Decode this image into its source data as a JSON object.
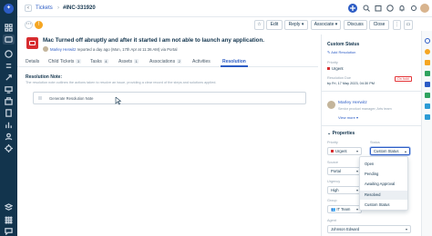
{
  "breadcrumb": {
    "parent": "Tickets",
    "current": "#INC-331920"
  },
  "toolbar": {
    "edit": "Edit",
    "reply": "Reply",
    "associate": "Associate",
    "discuss": "Discuss",
    "close": "Close"
  },
  "ticket": {
    "title": "Mac Turned off abruptly and after it started I am not able to launch any application.",
    "requester": "Marley Herwitz",
    "meta": "reported a day ago (Mon, 17th Apr at 11:36 AM) via Portal"
  },
  "tabs": [
    {
      "label": "Details"
    },
    {
      "label": "Child Tickets",
      "count": "3"
    },
    {
      "label": "Tasks",
      "count": "4"
    },
    {
      "label": "Assets",
      "count": "1"
    },
    {
      "label": "Associations",
      "count": "2"
    },
    {
      "label": "Activities"
    },
    {
      "label": "Resolution",
      "active": true
    }
  ],
  "resolution": {
    "title": "Resolution Note:",
    "description": "The resolution note outlines the actions taken to resolve an issue, providing a clear record of the steps and solutions applied.",
    "generate_label": "Generate Resolution Note"
  },
  "status_card": {
    "title": "Custom Status",
    "add_resolution": "Add Resolution",
    "priority_label": "Priority",
    "priority_value": "Urgent",
    "resolution_due_label": "Resolution Due",
    "resolution_due_value": "by Fri, 17 May 2023, 04:30 PM",
    "resolution_badge": "On hold"
  },
  "requester_card": {
    "name": "Marley Herwitz",
    "role": "Senior product manager, Arts team",
    "view_more": "View more"
  },
  "properties": {
    "title": "Properties",
    "priority_label": "Priority",
    "priority_value": "Urgent",
    "status_label": "Status",
    "status_value": "Custom Status",
    "source_label": "Source",
    "source_value": "Portal",
    "urgency_label": "Urgency",
    "urgency_value": "High",
    "group_label": "Group",
    "group_value": "IT Team",
    "agent_label": "Agent",
    "agent_value": "Johnson Edward"
  },
  "status_options": [
    "Open",
    "Pending",
    "Awaiting Approval",
    "Resolved",
    "Custom Status"
  ],
  "colors": {
    "accent": "#2c5cc5",
    "rail": "#12344d",
    "urgent": "#d72d30",
    "danger_badge": "#e43538"
  }
}
